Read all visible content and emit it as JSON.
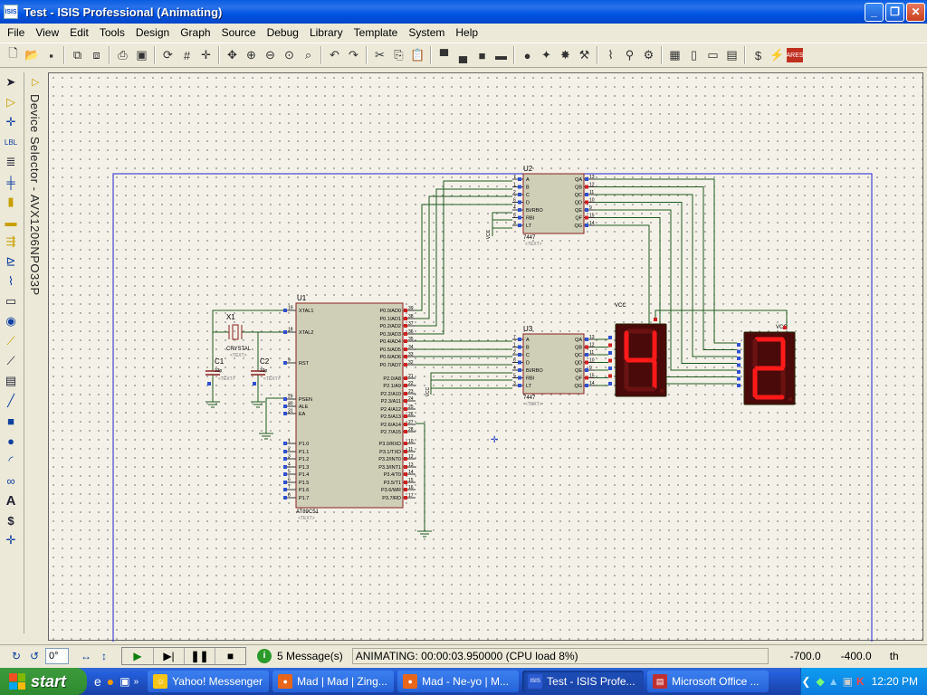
{
  "window": {
    "title": "Test - ISIS Professional (Animating)",
    "icon_label": "ISIS"
  },
  "menu": [
    "File",
    "View",
    "Edit",
    "Tools",
    "Design",
    "Graph",
    "Source",
    "Debug",
    "Library",
    "Template",
    "System",
    "Help"
  ],
  "device_selector": {
    "label": "Device Selector - AVX1206NPO33P"
  },
  "status": {
    "rotation": "0°",
    "messages": "5 Message(s)",
    "animating": "ANIMATING: 00:00:03.950000 (CPU load 8%)",
    "coord_x": "-700.0",
    "coord_y": "-400.0",
    "units": "th"
  },
  "taskbar": {
    "start": "start",
    "tasks": [
      {
        "label": "Yahoo! Messenger",
        "icon": "yahoo-smiley-icon",
        "color": "#f5c518"
      },
      {
        "label": "Mad | Mad | Zing...",
        "icon": "firefox-icon",
        "color": "#e8661a"
      },
      {
        "label": "Mad - Ne-yo | M...",
        "icon": "firefox-icon",
        "color": "#e8661a"
      },
      {
        "label": "Test - ISIS Profe...",
        "icon": "isis-icon",
        "color": "#2a5bd0"
      },
      {
        "label": "Microsoft Office ...",
        "icon": "office-icon",
        "color": "#c03030"
      }
    ],
    "clock": "12:20 PM"
  },
  "schematic": {
    "u1": {
      "ref": "U1",
      "part": "AT89C51",
      "text": "<TEXT>",
      "left_pins": [
        {
          "num": "19",
          "name": "XTAL1"
        },
        {
          "num": "18",
          "name": "XTAL2"
        },
        {
          "num": "9",
          "name": "RST"
        },
        {
          "num": "29",
          "name": "PSEN"
        },
        {
          "num": "30",
          "name": "ALE"
        },
        {
          "num": "31",
          "name": "EA"
        },
        {
          "num": "1",
          "name": "P1.0"
        },
        {
          "num": "2",
          "name": "P1.1"
        },
        {
          "num": "3",
          "name": "P1.2"
        },
        {
          "num": "4",
          "name": "P1.3"
        },
        {
          "num": "5",
          "name": "P1.4"
        },
        {
          "num": "6",
          "name": "P1.5"
        },
        {
          "num": "7",
          "name": "P1.6"
        },
        {
          "num": "8",
          "name": "P1.7"
        }
      ],
      "right_pins": [
        {
          "num": "39",
          "name": "P0.0/AD0"
        },
        {
          "num": "38",
          "name": "P0.1/AD1"
        },
        {
          "num": "37",
          "name": "P0.2/AD2"
        },
        {
          "num": "36",
          "name": "P0.3/AD3"
        },
        {
          "num": "35",
          "name": "P0.4/AD4"
        },
        {
          "num": "34",
          "name": "P0.5/AD5"
        },
        {
          "num": "33",
          "name": "P0.6/AD6"
        },
        {
          "num": "32",
          "name": "P0.7/AD7"
        },
        {
          "num": "21",
          "name": "P2.0/A8"
        },
        {
          "num": "22",
          "name": "P2.1/A9"
        },
        {
          "num": "23",
          "name": "P2.2/A10"
        },
        {
          "num": "24",
          "name": "P2.3/A11"
        },
        {
          "num": "25",
          "name": "P2.4/A12"
        },
        {
          "num": "26",
          "name": "P2.5/A13"
        },
        {
          "num": "27",
          "name": "P2.6/A14"
        },
        {
          "num": "28",
          "name": "P2.7/A15"
        },
        {
          "num": "10",
          "name": "P3.0/RXD"
        },
        {
          "num": "11",
          "name": "P3.1/TXD"
        },
        {
          "num": "12",
          "name": "P3.2/INT0"
        },
        {
          "num": "13",
          "name": "P3.3/INT1"
        },
        {
          "num": "14",
          "name": "P3.4/T0"
        },
        {
          "num": "15",
          "name": "P3.5/T1"
        },
        {
          "num": "16",
          "name": "P3.6/WR"
        },
        {
          "num": "17",
          "name": "P3.7/RD"
        }
      ]
    },
    "decoders": {
      "u2": {
        "ref": "U2",
        "part": "7447",
        "text": "<TEXT>"
      },
      "u3": {
        "ref": "U3",
        "part": "7447",
        "text": "<TEXT>"
      },
      "left_pins": [
        {
          "num": "7",
          "name": "A"
        },
        {
          "num": "1",
          "name": "B"
        },
        {
          "num": "2",
          "name": "C"
        },
        {
          "num": "6",
          "name": "D"
        },
        {
          "num": "4",
          "name": "BI/RBO"
        },
        {
          "num": "5",
          "name": "RBI"
        },
        {
          "num": "3",
          "name": "LT"
        }
      ],
      "right_pins": [
        {
          "num": "13",
          "name": "QA"
        },
        {
          "num": "12",
          "name": "QB"
        },
        {
          "num": "11",
          "name": "QC"
        },
        {
          "num": "10",
          "name": "QD"
        },
        {
          "num": "9",
          "name": "QE"
        },
        {
          "num": "15",
          "name": "QF"
        },
        {
          "num": "14",
          "name": "QG"
        }
      ]
    },
    "crystal": {
      "ref": "X1",
      "part": "CRYSTAL",
      "text": "<TEXT>"
    },
    "c1": {
      "ref": "C1",
      "value": "33p",
      "text": "<TEXT>"
    },
    "c2": {
      "ref": "C2",
      "value": "33p",
      "text": "<TEXT>"
    },
    "vcc": "VCC",
    "display_left_digit": "4",
    "display_right_digit": "2"
  }
}
